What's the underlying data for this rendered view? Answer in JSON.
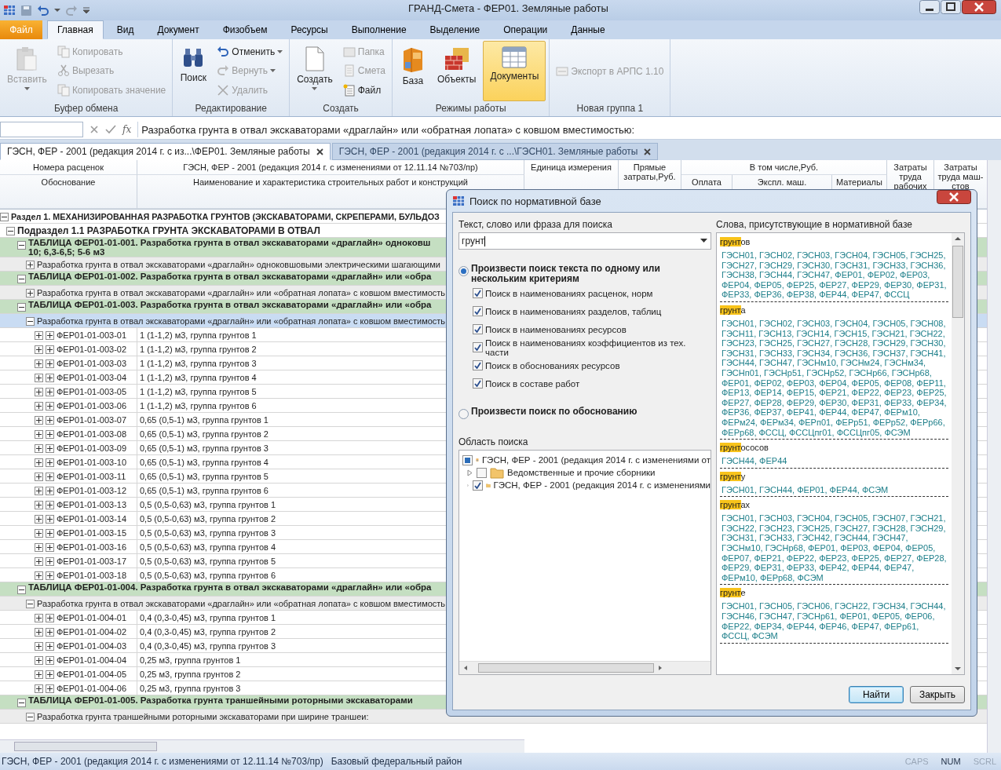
{
  "window": {
    "title": "ГРАНД-Смета - ФЕР01. Земляные работы"
  },
  "ribbon": {
    "file_button": "Файл",
    "tabs": [
      {
        "label": "Главная",
        "selected": true
      },
      {
        "label": "Вид",
        "selected": false
      },
      {
        "label": "Документ",
        "selected": false
      },
      {
        "label": "Физобъем",
        "selected": false
      },
      {
        "label": "Ресурсы",
        "selected": false
      },
      {
        "label": "Выполнение",
        "selected": false
      },
      {
        "label": "Выделение",
        "selected": false
      },
      {
        "label": "Операции",
        "selected": false
      },
      {
        "label": "Данные",
        "selected": false
      }
    ],
    "groups": [
      {
        "label": "Буфер обмена",
        "items": [
          {
            "label": "Вставить",
            "kind": "large",
            "disabled": true,
            "dropdown": true
          },
          {
            "label": "Копировать",
            "kind": "small",
            "disabled": true,
            "dropdown": false
          },
          {
            "label": "Вырезать",
            "kind": "small",
            "disabled": true,
            "dropdown": false
          },
          {
            "label": "Копировать значение",
            "kind": "small",
            "disabled": true,
            "dropdown": false
          }
        ]
      },
      {
        "label": "Редактирование",
        "items": [
          {
            "label": "Поиск",
            "kind": "large",
            "disabled": false,
            "dropdown": false
          },
          {
            "label": "Отменить",
            "kind": "small",
            "disabled": false,
            "dropdown": true
          },
          {
            "label": "Вернуть",
            "kind": "small",
            "disabled": true,
            "dropdown": true
          },
          {
            "label": "Удалить",
            "kind": "small",
            "disabled": true,
            "dropdown": false
          }
        ]
      },
      {
        "label": "Создать",
        "items": [
          {
            "label": "Создать",
            "kind": "large",
            "disabled": false,
            "dropdown": true
          },
          {
            "label": "Папка",
            "kind": "small",
            "disabled": true,
            "dropdown": false
          },
          {
            "label": "Смета",
            "kind": "small",
            "disabled": true,
            "dropdown": false
          },
          {
            "label": "Файл",
            "kind": "small",
            "disabled": false,
            "dropdown": false
          }
        ]
      },
      {
        "label": "Режимы работы",
        "items": [
          {
            "label": "База",
            "kind": "large",
            "disabled": false,
            "dropdown": false,
            "selected": false
          },
          {
            "label": "Объекты",
            "kind": "large",
            "disabled": false,
            "dropdown": false,
            "selected": false
          },
          {
            "label": "Документы",
            "kind": "large",
            "disabled": false,
            "dropdown": false,
            "selected": true
          }
        ]
      },
      {
        "label": "Новая группа 1",
        "items": [
          {
            "label": "Экспорт в АРПС 1.10",
            "kind": "small",
            "disabled": true,
            "dropdown": false
          }
        ]
      }
    ]
  },
  "formula_bar": {
    "function_label": "fx",
    "value": "Разработка грунта в отвал экскаваторами «драглайн» или «обратная лопата» с ковшом вместимостью:"
  },
  "doc_tabs": [
    {
      "label": "ГЭСН, ФЕР - 2001 (редакция 2014 г. с из...\\ФЕР01. Земляные работы",
      "selected": true
    },
    {
      "label": "ГЭСН, ФЕР - 2001 (редакция 2014 г. с ...\\ГЭСН01. Земляные работы",
      "selected": false
    }
  ],
  "table": {
    "header": {
      "code_top": "Номера расценок",
      "code_bottom": "Обоснование",
      "base_title": "ГЭСН, ФЕР - 2001 (редакция 2014 г. с изменениями от  12.11.14 №703/пр)",
      "name": "Наименование и характеристика строительных работ и конструкций",
      "unit": "Единица измерения",
      "direct": "Прямые затраты,Руб.",
      "including": "В том числе,Руб.",
      "labor_pay": "Оплата",
      "machines": "Экспл. маш.",
      "materials": "Материалы",
      "labor_workers": "Затраты труда рабочих",
      "labor_machinists": "Затраты труда маш-стов"
    },
    "rows": [
      {
        "kind": "section",
        "expanded": true,
        "selected": false,
        "name": "Раздел 1. МЕХАНИЗИРОВАННАЯ РАЗРАБОТКА ГРУНТОВ (ЭКСКАВАТОРАМИ, СКРЕПЕРАМИ, БУЛЬДОЗ"
      },
      {
        "kind": "subsection",
        "expanded": true,
        "selected": false,
        "name": "Подраздел 1.1 РАЗРАБОТКА ГРУНТА ЭКСКАВАТОРАМИ В ОТВАЛ"
      },
      {
        "kind": "table",
        "expanded": true,
        "selected": false,
        "name": "ТАБЛИЦА ФЕР01-01-001. Разработка грунта в отвал экскаваторами «драглайн» одноковш",
        "name_continued": "10; 6,3-6,5; 5-6 м3"
      },
      {
        "kind": "group",
        "expanded": false,
        "selected": false,
        "name": "Разработка грунта в отвал экскаваторами «драглайн» одноковшовыми электрическими шагающими"
      },
      {
        "kind": "table",
        "expanded": true,
        "selected": false,
        "name": "ТАБЛИЦА ФЕР01-01-002. Разработка грунта в отвал экскаваторами «драглайн» или «обра"
      },
      {
        "kind": "group",
        "expanded": false,
        "selected": false,
        "name": "Разработка грунта в отвал экскаваторами «драглайн» или «обратная лопата» с ковшом вместимость"
      },
      {
        "kind": "table",
        "expanded": true,
        "selected": false,
        "name": "ТАБЛИЦА ФЕР01-01-003. Разработка грунта в отвал экскаваторами «драглайн» или «обра"
      },
      {
        "kind": "group",
        "expanded": true,
        "selected": true,
        "name": "Разработка грунта в отвал экскаваторами «драглайн» или «обратная лопата» с ковшом вместимость"
      },
      {
        "kind": "item",
        "expanded": false,
        "selected": false,
        "code": "ФЕР01-01-003-01",
        "name": "1 (1-1,2) м3, группа грунтов 1"
      },
      {
        "kind": "item",
        "expanded": false,
        "selected": false,
        "code": "ФЕР01-01-003-02",
        "name": "1 (1-1,2) м3, группа грунтов 2"
      },
      {
        "kind": "item",
        "expanded": false,
        "selected": false,
        "code": "ФЕР01-01-003-03",
        "name": "1 (1-1,2) м3, группа грунтов 3"
      },
      {
        "kind": "item",
        "expanded": false,
        "selected": false,
        "code": "ФЕР01-01-003-04",
        "name": "1 (1-1,2) м3, группа грунтов 4"
      },
      {
        "kind": "item",
        "expanded": false,
        "selected": false,
        "code": "ФЕР01-01-003-05",
        "name": "1 (1-1,2) м3, группа грунтов 5"
      },
      {
        "kind": "item",
        "expanded": false,
        "selected": false,
        "code": "ФЕР01-01-003-06",
        "name": "1 (1-1,2) м3, группа грунтов 6"
      },
      {
        "kind": "item",
        "expanded": false,
        "selected": false,
        "code": "ФЕР01-01-003-07",
        "name": "0,65 (0,5-1) м3, группа грунтов 1"
      },
      {
        "kind": "item",
        "expanded": false,
        "selected": false,
        "code": "ФЕР01-01-003-08",
        "name": "0,65 (0,5-1) м3, группа грунтов 2"
      },
      {
        "kind": "item",
        "expanded": false,
        "selected": false,
        "code": "ФЕР01-01-003-09",
        "name": "0,65 (0,5-1) м3, группа грунтов 3"
      },
      {
        "kind": "item",
        "expanded": false,
        "selected": false,
        "code": "ФЕР01-01-003-10",
        "name": "0,65 (0,5-1) м3, группа грунтов 4"
      },
      {
        "kind": "item",
        "expanded": false,
        "selected": false,
        "code": "ФЕР01-01-003-11",
        "name": "0,65 (0,5-1) м3, группа грунтов 5"
      },
      {
        "kind": "item",
        "expanded": false,
        "selected": false,
        "code": "ФЕР01-01-003-12",
        "name": "0,65 (0,5-1) м3, группа грунтов 6"
      },
      {
        "kind": "item",
        "expanded": false,
        "selected": false,
        "code": "ФЕР01-01-003-13",
        "name": "0,5 (0,5-0,63) м3, группа грунтов 1"
      },
      {
        "kind": "item",
        "expanded": false,
        "selected": false,
        "code": "ФЕР01-01-003-14",
        "name": "0,5 (0,5-0,63) м3, группа грунтов 2"
      },
      {
        "kind": "item",
        "expanded": false,
        "selected": false,
        "code": "ФЕР01-01-003-15",
        "name": "0,5 (0,5-0,63) м3, группа грунтов 3"
      },
      {
        "kind": "item",
        "expanded": false,
        "selected": false,
        "code": "ФЕР01-01-003-16",
        "name": "0,5 (0,5-0,63) м3, группа грунтов 4"
      },
      {
        "kind": "item",
        "expanded": false,
        "selected": false,
        "code": "ФЕР01-01-003-17",
        "name": "0,5 (0,5-0,63) м3, группа грунтов 5"
      },
      {
        "kind": "item",
        "expanded": false,
        "selected": false,
        "code": "ФЕР01-01-003-18",
        "name": "0,5 (0,5-0,63) м3, группа грунтов 6"
      },
      {
        "kind": "table",
        "expanded": true,
        "selected": false,
        "name": "ТАБЛИЦА ФЕР01-01-004. Разработка грунта в отвал экскаваторами «драглайн» или «обра"
      },
      {
        "kind": "group",
        "expanded": true,
        "selected": false,
        "name": "Разработка грунта в отвал экскаваторами «драглайн» или «обратная лопата» с ковшом вместимость"
      },
      {
        "kind": "item",
        "expanded": false,
        "selected": false,
        "code": "ФЕР01-01-004-01",
        "name": "0,4 (0,3-0,45) м3, группа грунтов 1"
      },
      {
        "kind": "item",
        "expanded": false,
        "selected": false,
        "code": "ФЕР01-01-004-02",
        "name": "0,4 (0,3-0,45) м3, группа грунтов 2"
      },
      {
        "kind": "item",
        "expanded": false,
        "selected": false,
        "code": "ФЕР01-01-004-03",
        "name": "0,4 (0,3-0,45) м3, группа грунтов 3"
      },
      {
        "kind": "item",
        "expanded": false,
        "selected": false,
        "code": "ФЕР01-01-004-04",
        "name": "0,25 м3, группа грунтов 1"
      },
      {
        "kind": "item",
        "expanded": false,
        "selected": false,
        "code": "ФЕР01-01-004-05",
        "name": "0,25 м3, группа грунтов 2"
      },
      {
        "kind": "item",
        "expanded": false,
        "selected": false,
        "code": "ФЕР01-01-004-06",
        "name": "0,25 м3, группа грунтов 3"
      },
      {
        "kind": "table",
        "expanded": true,
        "selected": false,
        "name": "ТАБЛИЦА ФЕР01-01-005. Разработка грунта траншейными роторными экскаваторами"
      },
      {
        "kind": "group",
        "expanded": true,
        "selected": false,
        "name": "Разработка грунта траншейными роторными экскаваторами при ширине траншеи:"
      }
    ]
  },
  "dialog": {
    "title": "Поиск по нормативной базе",
    "search_label": "Текст, слово или фраза для поиска",
    "search_value": "грунт",
    "modes": [
      {
        "label": "Произвести поиск текста по одному или нескольким критериям",
        "selected": true,
        "options": [
          {
            "label": "Поиск в наименованиях расценок, норм",
            "checked": true
          },
          {
            "label": "Поиск в наименованиях разделов, таблиц",
            "checked": true
          },
          {
            "label": "Поиск в наименованиях ресурсов",
            "checked": true
          },
          {
            "label": "Поиск в наименованиях коэффициентов из тех. части",
            "checked": true
          },
          {
            "label": "Поиск в обоснованиях ресурсов",
            "checked": true
          },
          {
            "label": "Поиск в составе работ",
            "checked": true
          }
        ]
      },
      {
        "label": "Произвести поиск по обоснованию",
        "selected": false
      }
    ],
    "area_label": "Область поиска",
    "tree": [
      {
        "label": "ГЭСН, ФЕР - 2001 (редакция 2014 г. с изменениями от",
        "indeterminate": true,
        "children": [
          {
            "label": "Ведомственные и прочие сборники",
            "checked": false,
            "expanded": false
          },
          {
            "label": "ГЭСН, ФЕР - 2001 (редакция 2014 г. с изменениями",
            "checked": true,
            "expanded": false
          }
        ]
      }
    ],
    "words_label": "Слова, присутствующие в нормативной базе",
    "words": [
      {
        "match": "грунт",
        "suffix": "ов",
        "refs": "ГЭСН01, ГЭСН02, ГЭСН03, ГЭСН04, ГЭСН05, ГЭСН25, ГЭСН27, ГЭСН29, ГЭСН30, ГЭСН31, ГЭСН33, ГЭСН36, ГЭСН38, ГЭСН44, ГЭСН47, ФЕР01, ФЕР02, ФЕР03, ФЕР04, ФЕР05, ФЕР25, ФЕР27, ФЕР29, ФЕР30, ФЕР31, ФЕР33, ФЕР36, ФЕР38, ФЕР44, ФЕР47, ФССЦ"
      },
      {
        "match": "грунт",
        "suffix": "а",
        "refs": "ГЭСН01, ГЭСН02, ГЭСН03, ГЭСН04, ГЭСН05, ГЭСН08, ГЭСН11, ГЭСН13, ГЭСН14, ГЭСН15, ГЭСН21, ГЭСН22, ГЭСН23, ГЭСН25, ГЭСН27, ГЭСН28, ГЭСН29, ГЭСН30, ГЭСН31, ГЭСН33, ГЭСН34, ГЭСН36, ГЭСН37, ГЭСН41, ГЭСН44, ГЭСН47, ГЭСНм10, ГЭСНм24, ГЭСНм34, ГЭСНп01, ГЭСНр51, ГЭСНр52, ГЭСНр66, ГЭСНр68, ФЕР01, ФЕР02, ФЕР03, ФЕР04, ФЕР05, ФЕР08, ФЕР11, ФЕР13, ФЕР14, ФЕР15, ФЕР21, ФЕР22, ФЕР23, ФЕР25, ФЕР27, ФЕР28, ФЕР29, ФЕР30, ФЕР31, ФЕР33, ФЕР34, ФЕР36, ФЕР37, ФЕР41, ФЕР44, ФЕР47, ФЕРм10, ФЕРм24, ФЕРм34, ФЕРп01, ФЕРр51, ФЕРр52, ФЕРр66, ФЕРр68, ФССЦ, ФССЦпг01, ФССЦпг05, ФСЭМ"
      },
      {
        "match": "грунт",
        "suffix": "ососов",
        "refs": "ГЭСН44, ФЕР44"
      },
      {
        "match": "грунт",
        "suffix": "у",
        "refs": "ГЭСН01, ГЭСН44, ФЕР01, ФЕР44, ФСЭМ"
      },
      {
        "match": "грунт",
        "suffix": "ах",
        "refs": "ГЭСН01, ГЭСН03, ГЭСН04, ГЭСН05, ГЭСН07, ГЭСН21, ГЭСН22, ГЭСН23, ГЭСН25, ГЭСН27, ГЭСН28, ГЭСН29, ГЭСН31, ГЭСН33, ГЭСН42, ГЭСН44, ГЭСН47, ГЭСНм10, ГЭСНр68, ФЕР01, ФЕР03, ФЕР04, ФЕР05, ФЕР07, ФЕР21, ФЕР22, ФЕР23, ФЕР25, ФЕР27, ФЕР28, ФЕР29, ФЕР31, ФЕР33, ФЕР42, ФЕР44, ФЕР47, ФЕРм10, ФЕРр68, ФСЭМ"
      },
      {
        "match": "грунт",
        "suffix": "е",
        "refs": "ГЭСН01, ГЭСН05, ГЭСН06, ГЭСН22, ГЭСН34, ГЭСН44, ГЭСН46, ГЭСН47, ГЭСНр61, ФЕР01, ФЕР05, ФЕР06, ФЕР22, ФЕР34, ФЕР44, ФЕР46, ФЕР47, ФЕРр61, ФССЦ, ФСЭМ"
      }
    ],
    "buttons": [
      {
        "label": "Найти",
        "kind": "default"
      },
      {
        "label": "Закрыть",
        "kind": "normal"
      }
    ]
  },
  "status_bar": {
    "base": "ГЭСН, ФЕР - 2001 (редакция 2014 г. с изменениями от 12.11.14 №703/пр)",
    "region": "Базовый федеральный район",
    "indicators": [
      {
        "label": "CAPS",
        "on": false
      },
      {
        "label": "NUM",
        "on": true
      },
      {
        "label": "SCRL",
        "on": false
      }
    ]
  }
}
